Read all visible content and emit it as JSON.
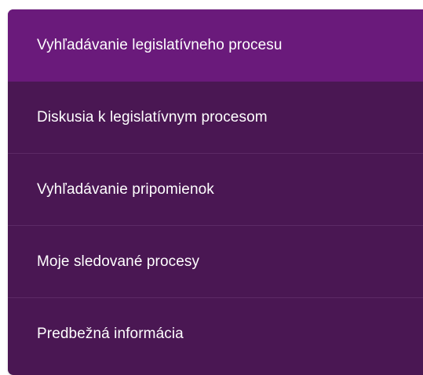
{
  "menu": {
    "items": [
      {
        "label": "Vyhľadávanie legislatívneho procesu",
        "active": true
      },
      {
        "label": "Diskusia k legislatívnym procesom",
        "active": false
      },
      {
        "label": "Vyhľadávanie pripomienok",
        "active": false
      },
      {
        "label": "Moje sledované procesy",
        "active": false
      },
      {
        "label": "Predbežná informácia",
        "active": false
      }
    ]
  },
  "colors": {
    "menu_bg": "#4a1753",
    "active_bg": "#6a1a7b",
    "divider": "#5c2a66",
    "text": "#ffffff"
  }
}
